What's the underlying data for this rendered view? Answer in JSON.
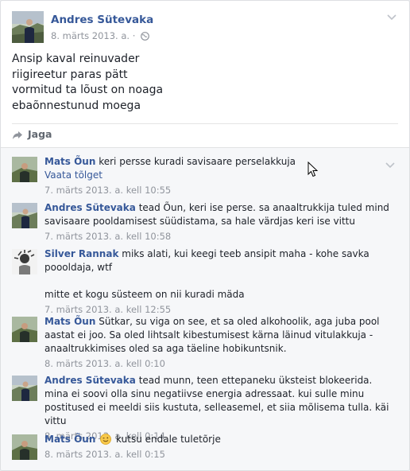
{
  "post": {
    "author": "Andres Sütevaka",
    "date": "8. märts 2013. a.",
    "separator": "·",
    "lines": [
      "Ansip kaval reinuvader",
      "riigireetur paras pätt",
      "vormitud ta lõust on noaga",
      "ebaõnnestunud moega"
    ],
    "share_label": "Jaga"
  },
  "comments": [
    {
      "author": "Mats Õun",
      "text": "keri persse kuradi savisaare perselakkuja",
      "link": "Vaata tõlget",
      "time": "7. märts 2013. a. kell 10:55"
    },
    {
      "author": "Andres Sütevaka",
      "text": "tead Õun, keri ise perse. sa anaaltrukkija tuled mind savisaare pooldamisest süüdistama, sa hale värdjas keri ise vittu",
      "time": "7. märts 2013. a. kell 10:58"
    },
    {
      "author": "Silver Rannak",
      "text": "miks alati, kui keegi teeb ansipit maha - kohe savka poooldaja, wtf",
      "extra": "mitte et kogu süsteem on nii kuradi mäda",
      "time": "7. märts 2013. a. kell 12:55"
    },
    {
      "author": "Mats Õun",
      "text": "Sütkar, su viga on see, et sa oled alkohoolik, aga juba pool aastat ei joo. Sa oled lihtsalt kibestumisest kärna läinud vitulakkuja - anaaltrukkimises oled sa aga täeline hobikuntsnik.",
      "time": "8. märts 2013. a. kell 0:10"
    },
    {
      "author": "Andres Sütevaka",
      "text": "tead munn, teen ettepaneku üksteist blokeerida. mina ei soovi olla sinu negatiivse energia adressaat. kui sulle minu postitused ei meeldi siis kustuta, selleasemel, et siia mõlisema tulla. käi vittu",
      "time": "8. märts 2013. a. kell 0:14"
    },
    {
      "author": "Mats Õun",
      "emoji": "wink-emoji",
      "text": "kutsu endale tuletõrje",
      "time": "8. märts 2013. a. kell 0:15"
    }
  ],
  "icons": {
    "privacy": "globe-icon",
    "share": "share-arrow-icon",
    "post_menu": "chevron-down-icon",
    "comment_menu": "chevron-down-icon",
    "cursor": "mouse-pointer-icon"
  },
  "colors": {
    "name_link": "#365899",
    "text": "#1d2129",
    "meta": "#90949c",
    "comments_bg": "#f6f7f9"
  }
}
